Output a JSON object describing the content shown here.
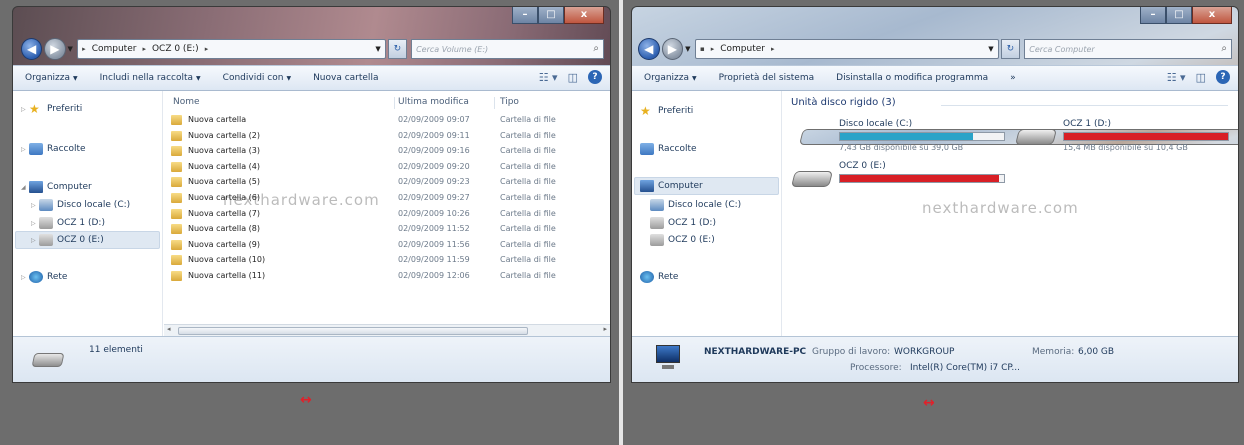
{
  "colors": {
    "accent": "#1e395b",
    "bar_normal": "#2aa3c8",
    "bar_full": "#d81f26",
    "arrow": "#e0202a"
  },
  "arrow_symbol": "↔",
  "left": {
    "window_buttons": {
      "minimize": "–",
      "maximize": "□",
      "close": "x"
    },
    "breadcrumb": [
      "Computer",
      "OCZ 0 (E:)"
    ],
    "search_placeholder": "Cerca Volume (E:)",
    "toolbar": [
      "Organizza",
      "Includi nella raccolta",
      "Condividi con",
      "Nuova cartella"
    ],
    "sidebar": {
      "favorites": "Preferiti",
      "libraries": "Raccolte",
      "computer": "Computer",
      "drive_c": "Disco locale (C:)",
      "drive_d": "OCZ 1 (D:)",
      "drive_e": "OCZ 0 (E:)",
      "network": "Rete"
    },
    "columns": {
      "name": "Nome",
      "modified": "Ultima modifica",
      "type": "Tipo"
    },
    "files": [
      {
        "name": "Nuova cartella",
        "date": "02/09/2009 09:07",
        "type": "Cartella di file"
      },
      {
        "name": "Nuova cartella (2)",
        "date": "02/09/2009 09:11",
        "type": "Cartella di file"
      },
      {
        "name": "Nuova cartella (3)",
        "date": "02/09/2009 09:16",
        "type": "Cartella di file"
      },
      {
        "name": "Nuova cartella (4)",
        "date": "02/09/2009 09:20",
        "type": "Cartella di file"
      },
      {
        "name": "Nuova cartella (5)",
        "date": "02/09/2009 09:23",
        "type": "Cartella di file"
      },
      {
        "name": "Nuova cartella (6)",
        "date": "02/09/2009 09:27",
        "type": "Cartella di file"
      },
      {
        "name": "Nuova cartella (7)",
        "date": "02/09/2009 10:26",
        "type": "Cartella di file"
      },
      {
        "name": "Nuova cartella (8)",
        "date": "02/09/2009 11:52",
        "type": "Cartella di file"
      },
      {
        "name": "Nuova cartella (9)",
        "date": "02/09/2009 11:56",
        "type": "Cartella di file"
      },
      {
        "name": "Nuova cartella (10)",
        "date": "02/09/2009 11:59",
        "type": "Cartella di file"
      },
      {
        "name": "Nuova cartella (11)",
        "date": "02/09/2009 12:06",
        "type": "Cartella di file"
      }
    ],
    "status": "11 elementi",
    "watermark": "nexthardware.com"
  },
  "right": {
    "window_buttons": {
      "minimize": "–",
      "maximize": "□",
      "close": "x"
    },
    "breadcrumb": [
      "Computer"
    ],
    "search_placeholder": "Cerca Computer",
    "toolbar": [
      "Organizza",
      "Proprietà del sistema",
      "Disinstalla o modifica programma",
      "»"
    ],
    "sidebar": {
      "favorites": "Preferiti",
      "libraries": "Raccolte",
      "computer": "Computer",
      "drive_c": "Disco locale (C:)",
      "drive_d": "OCZ 1 (D:)",
      "drive_e": "OCZ 0 (E:)",
      "network": "Rete"
    },
    "group_title": "Unità disco rigido (3)",
    "drives": [
      {
        "name": "Disco locale (C:)",
        "free": "7,43 GB disponibile su 39,0 GB",
        "used_fraction": 0.81,
        "color": "#2aa3c8"
      },
      {
        "name": "OCZ 1 (D:)",
        "free": "15,4 MB disponibile su 10,4 GB",
        "used_fraction": 0.998,
        "color": "#d81f26"
      },
      {
        "name": "OCZ 0 (E:)",
        "free": "",
        "used_fraction": 0.97,
        "color": "#d81f26"
      }
    ],
    "pc_name": "NEXTHARDWARE-PC",
    "workgroup_label": "Gruppo di lavoro:",
    "workgroup": "WORKGROUP",
    "memory_label": "Memoria:",
    "memory": "6,00 GB",
    "processor_label": "Processore:",
    "processor": "Intel(R) Core(TM) i7 CP...",
    "watermark": "nexthardware.com"
  }
}
